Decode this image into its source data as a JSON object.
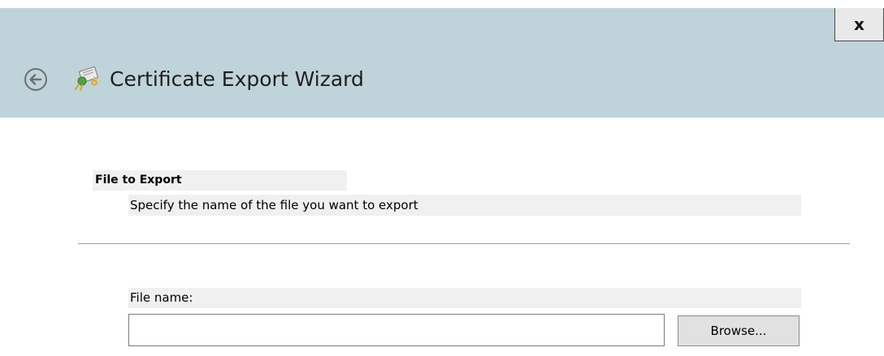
{
  "window": {
    "close_label": "x",
    "title": "Certificate Export Wizard"
  },
  "icons": {
    "back": "back-arrow-icon",
    "wizard": "certificate-wizard-icon",
    "close": "close-icon"
  },
  "page": {
    "heading": "File to Export",
    "subheading": "Specify the name of the file you want to export"
  },
  "form": {
    "file_name_label": "File name:",
    "file_name_value": "",
    "browse_label": "Browse..."
  },
  "colors": {
    "titlebar_bg": "#bfd3da",
    "panel_bg": "#ffffff",
    "label_bg": "#f0f0f0"
  }
}
